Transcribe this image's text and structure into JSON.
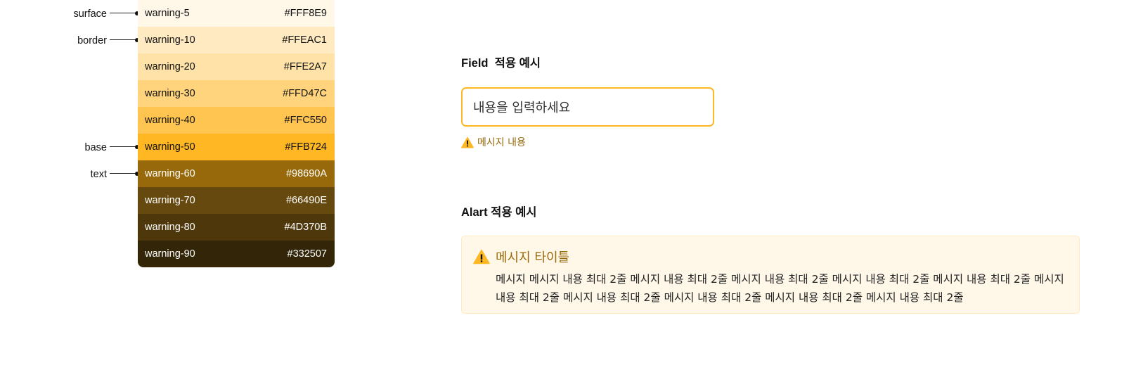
{
  "palette": [
    {
      "name": "warning-5",
      "hex": "#FFF8E9",
      "text_color": "#111111"
    },
    {
      "name": "warning-10",
      "hex": "#FFEAC1",
      "text_color": "#111111"
    },
    {
      "name": "warning-20",
      "hex": "#FFE2A7",
      "text_color": "#111111"
    },
    {
      "name": "warning-30",
      "hex": "#FFD47C",
      "text_color": "#111111"
    },
    {
      "name": "warning-40",
      "hex": "#FFC550",
      "text_color": "#111111"
    },
    {
      "name": "warning-50",
      "hex": "#FFB724",
      "text_color": "#111111"
    },
    {
      "name": "warning-60",
      "hex": "#98690A",
      "text_color": "#FFFFFF"
    },
    {
      "name": "warning-70",
      "hex": "#66490E",
      "text_color": "#FFFFFF"
    },
    {
      "name": "warning-80",
      "hex": "#4D370B",
      "text_color": "#FFFFFF"
    },
    {
      "name": "warning-90",
      "hex": "#332507",
      "text_color": "#FFFFFF"
    }
  ],
  "roles": {
    "surface": "surface",
    "border": "border",
    "base": "base",
    "text": "text"
  },
  "field_section": {
    "title": "Field  적용 예시",
    "input_placeholder": "내용을 입력하세요",
    "message": "메시지 내용",
    "icon": "warning-triangle-icon"
  },
  "alert_section": {
    "title": "Alart 적용 예시",
    "alert_title": "메시지 타이틀",
    "alert_body": "메시지 메시지 내용 최대 2줄 메시지 내용 최대 2줄 메시지 내용 최대 2줄 메시지 내용 최대 2줄 메시지 내용 최대 2줄 메시지 내용 최대 2줄 메시지 내용 최대 2줄 메시지 내용 최대 2줄 메시지 내용 최대 2줄 메시지 내용 최대 2줄",
    "icon": "warning-triangle-icon"
  },
  "colors": {
    "accent": "#FFB724",
    "message_text": "#98690A",
    "alert_bg": "#FFF8E9",
    "alert_border": "#FFEAC1"
  }
}
